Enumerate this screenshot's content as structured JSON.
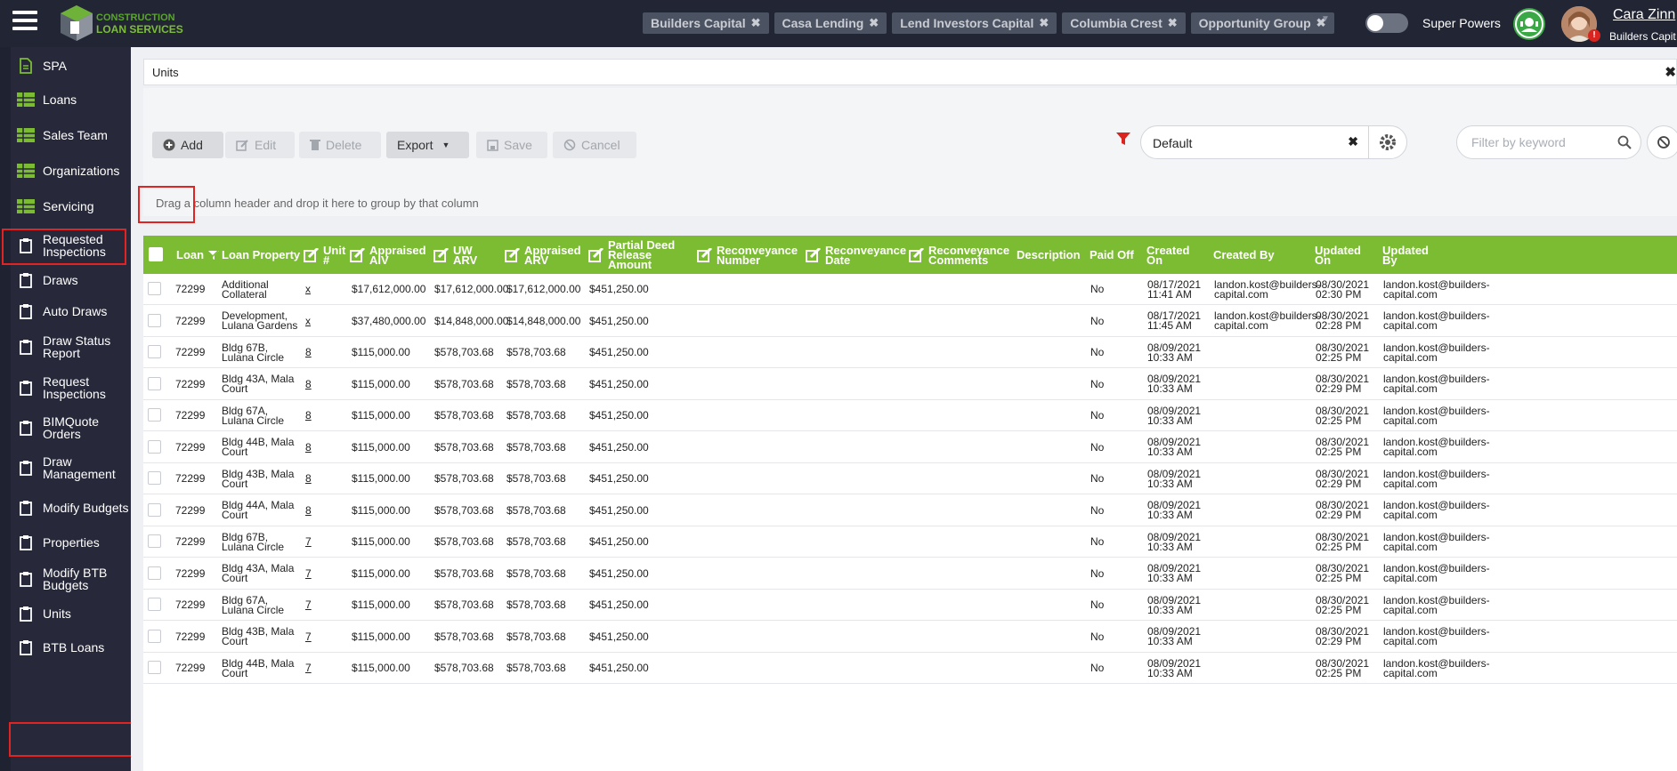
{
  "app": {
    "logo_line1": "CONSTRUCTION",
    "logo_line2": "LOAN SERVICES",
    "super_powers_label": "Super Powers",
    "user_name": "Cara Zinn",
    "user_org": "Builders Capit",
    "avatar_badge": "!"
  },
  "org_chips": [
    "Builders Capital",
    "Casa Lending",
    "Lend Investors Capital",
    "Columbia Crest",
    "Opportunity Group"
  ],
  "sidebar": {
    "items": [
      {
        "label": "SPA",
        "icon": "document-icon"
      },
      {
        "label": "Loans",
        "icon": "table-icon"
      },
      {
        "label": "Sales Team",
        "icon": "table-icon"
      },
      {
        "label": "Organizations",
        "icon": "table-icon"
      },
      {
        "label": "Servicing",
        "icon": "table-icon"
      },
      {
        "label": "Requested Inspections",
        "icon": "clipboard-icon"
      },
      {
        "label": "Draws",
        "icon": "clipboard-icon"
      },
      {
        "label": "Auto Draws",
        "icon": "clipboard-icon"
      },
      {
        "label": "Draw Status Report",
        "icon": "clipboard-icon"
      },
      {
        "label": "Request Inspections",
        "icon": "clipboard-icon"
      },
      {
        "label": "BIMQuote Orders",
        "icon": "clipboard-icon"
      },
      {
        "label": "Draw Management",
        "icon": "clipboard-icon"
      },
      {
        "label": "Modify Budgets",
        "icon": "clipboard-icon"
      },
      {
        "label": "Properties",
        "icon": "clipboard-icon"
      },
      {
        "label": "Modify BTB Budgets",
        "icon": "clipboard-icon"
      },
      {
        "label": "Units",
        "icon": "clipboard-icon"
      },
      {
        "label": "BTB Loans",
        "icon": "clipboard-icon"
      }
    ]
  },
  "panel": {
    "title": "Units",
    "close": "✖"
  },
  "toolbar": {
    "add": "Add",
    "edit": "Edit",
    "delete": "Delete",
    "export": "Export",
    "save": "Save",
    "cancel": "Cancel"
  },
  "view_select": {
    "value": "Default",
    "clear": "✖"
  },
  "keyword_filter": {
    "placeholder": "Filter by keyword"
  },
  "group_hint": "Drag a column header and drop it here to group by that column",
  "colors": {
    "header_green": "#7cbc33",
    "topbar": "#222534",
    "sidebar": "#27293a",
    "accent_red": "#e02424"
  },
  "grid": {
    "headers": [
      "Loan",
      "Loan Property",
      "Unit #",
      "Appraised AIV",
      "UW ARV",
      "Appraised ARV",
      "Partial Deed Release Amount",
      "Reconveyance Number",
      "Reconveyance Date",
      "Reconveyance Comments",
      "Description",
      "Paid Off",
      "Created On",
      "Created By",
      "Updated On",
      "Updated By"
    ],
    "rows": [
      [
        "72299",
        "Additional Collateral",
        "x",
        "$17,612,000.00",
        "$17,612,000.00",
        "$17,612,000.00",
        "$451,250.00",
        "No",
        "08/17/2021 11:41 AM",
        "landon.kost@builders-capital.com",
        "08/30/2021 02:30 PM",
        "landon.kost@builders-capital.com"
      ],
      [
        "72299",
        "Development, Lulana Gardens",
        "x",
        "$37,480,000.00",
        "$14,848,000.00",
        "$14,848,000.00",
        "$451,250.00",
        "No",
        "08/17/2021 11:45 AM",
        "landon.kost@builders-capital.com",
        "08/30/2021 02:28 PM",
        "landon.kost@builders-capital.com"
      ],
      [
        "72299",
        "Bldg 67B, Lulana Circle",
        "8",
        "$115,000.00",
        "$578,703.68",
        "$578,703.68",
        "$451,250.00",
        "No",
        "08/09/2021 10:33 AM",
        "",
        "08/30/2021 02:25 PM",
        "landon.kost@builders-capital.com"
      ],
      [
        "72299",
        "Bldg 43A, Mala Court",
        "8",
        "$115,000.00",
        "$578,703.68",
        "$578,703.68",
        "$451,250.00",
        "No",
        "08/09/2021 10:33 AM",
        "",
        "08/30/2021 02:29 PM",
        "landon.kost@builders-capital.com"
      ],
      [
        "72299",
        "Bldg 67A, Lulana Circle",
        "8",
        "$115,000.00",
        "$578,703.68",
        "$578,703.68",
        "$451,250.00",
        "No",
        "08/09/2021 10:33 AM",
        "",
        "08/30/2021 02:25 PM",
        "landon.kost@builders-capital.com"
      ],
      [
        "72299",
        "Bldg 44B, Mala Court",
        "8",
        "$115,000.00",
        "$578,703.68",
        "$578,703.68",
        "$451,250.00",
        "No",
        "08/09/2021 10:33 AM",
        "",
        "08/30/2021 02:25 PM",
        "landon.kost@builders-capital.com"
      ],
      [
        "72299",
        "Bldg 43B, Mala Court",
        "8",
        "$115,000.00",
        "$578,703.68",
        "$578,703.68",
        "$451,250.00",
        "No",
        "08/09/2021 10:33 AM",
        "",
        "08/30/2021 02:29 PM",
        "landon.kost@builders-capital.com"
      ],
      [
        "72299",
        "Bldg 44A, Mala Court",
        "8",
        "$115,000.00",
        "$578,703.68",
        "$578,703.68",
        "$451,250.00",
        "No",
        "08/09/2021 10:33 AM",
        "",
        "08/30/2021 02:29 PM",
        "landon.kost@builders-capital.com"
      ],
      [
        "72299",
        "Bldg 67B, Lulana Circle",
        "7",
        "$115,000.00",
        "$578,703.68",
        "$578,703.68",
        "$451,250.00",
        "No",
        "08/09/2021 10:33 AM",
        "",
        "08/30/2021 02:25 PM",
        "landon.kost@builders-capital.com"
      ],
      [
        "72299",
        "Bldg 43A, Mala Court",
        "7",
        "$115,000.00",
        "$578,703.68",
        "$578,703.68",
        "$451,250.00",
        "No",
        "08/09/2021 10:33 AM",
        "",
        "08/30/2021 02:25 PM",
        "landon.kost@builders-capital.com"
      ],
      [
        "72299",
        "Bldg 67A, Lulana Circle",
        "7",
        "$115,000.00",
        "$578,703.68",
        "$578,703.68",
        "$451,250.00",
        "No",
        "08/09/2021 10:33 AM",
        "",
        "08/30/2021 02:25 PM",
        "landon.kost@builders-capital.com"
      ],
      [
        "72299",
        "Bldg 43B, Mala Court",
        "7",
        "$115,000.00",
        "$578,703.68",
        "$578,703.68",
        "$451,250.00",
        "No",
        "08/09/2021 10:33 AM",
        "",
        "08/30/2021 02:29 PM",
        "landon.kost@builders-capital.com"
      ],
      [
        "72299",
        "Bldg 44B, Mala Court",
        "7",
        "$115,000.00",
        "$578,703.68",
        "$578,703.68",
        "$451,250.00",
        "No",
        "08/09/2021 10:33 AM",
        "",
        "08/30/2021 02:25 PM",
        "landon.kost@builders-capital.com"
      ]
    ]
  }
}
